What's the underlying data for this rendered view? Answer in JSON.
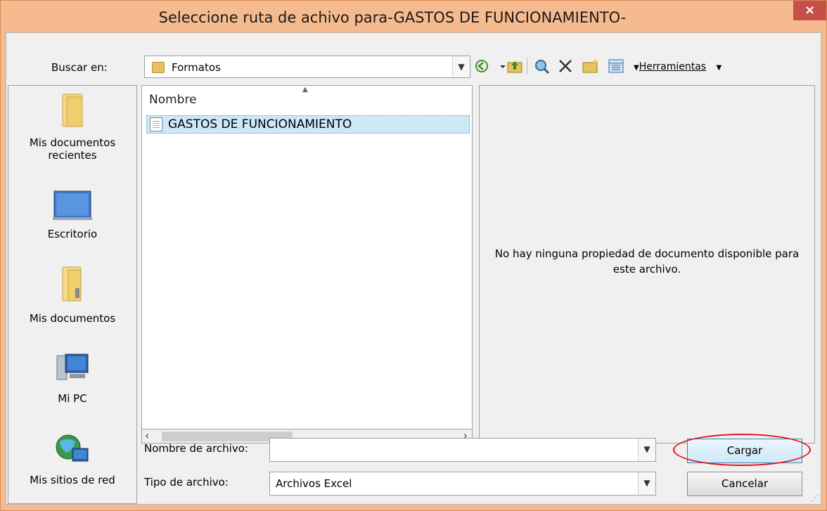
{
  "window": {
    "title": "Seleccione ruta de achivo para-GASTOS DE FUNCIONAMIENTO-",
    "close_glyph": "×"
  },
  "lookin": {
    "label": "Buscar en:",
    "value": "Formatos",
    "icon": "folder-icon"
  },
  "toolbar": {
    "back_icon": "back-icon",
    "up_folder_icon": "up-folder-icon",
    "search_web_icon": "search-web-icon",
    "delete_icon": "delete-icon",
    "new_folder_icon": "new-folder-icon",
    "views_icon": "views-icon",
    "tools_label": "Herramientas"
  },
  "places": [
    {
      "label": "Mis documentos recientes",
      "icon": "recent-documents-icon"
    },
    {
      "label": "Escritorio",
      "icon": "desktop-icon"
    },
    {
      "label": "Mis documentos",
      "icon": "my-documents-icon"
    },
    {
      "label": "Mi PC",
      "icon": "my-computer-icon"
    },
    {
      "label": "Mis sitios de red",
      "icon": "network-places-icon"
    }
  ],
  "filelist": {
    "column_header": "Nombre",
    "files": [
      {
        "name": "GASTOS DE FUNCIONAMIENTO",
        "selected": true
      }
    ]
  },
  "preview": {
    "message": "No hay ninguna propiedad de documento disponible para este archivo."
  },
  "filename": {
    "label": "Nombre de archivo:",
    "value": ""
  },
  "filetype": {
    "label": "Tipo de archivo:",
    "value": "Archivos Excel"
  },
  "buttons": {
    "load": "Cargar",
    "cancel": "Cancelar"
  },
  "colors": {
    "titlebar": "#f5bb8f",
    "close": "#c74f4a",
    "selection": "#cde8f7",
    "highlight_oval": "#e0141a"
  }
}
